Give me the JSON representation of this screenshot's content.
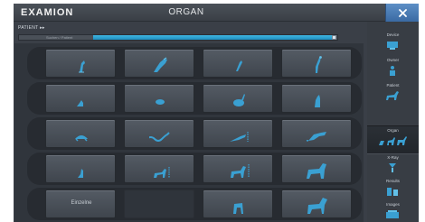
{
  "app": {
    "logo": "EXAMION",
    "title": "ORGAN",
    "close_icon": "close-icon"
  },
  "patient": {
    "label": "PATIENT ▸▸",
    "search_label": "Suchen / Patient",
    "search_value": ""
  },
  "grid": {
    "rows": [
      {
        "tiles": [
          {
            "icon": "rabbit-leg-icon"
          },
          {
            "icon": "small-animal-skull-icon"
          },
          {
            "icon": "small-animal-limb-icon"
          },
          {
            "icon": "bird-icon"
          }
        ]
      },
      {
        "tiles": [
          {
            "icon": "rodent-leg-icon"
          },
          {
            "icon": "fish-body-icon"
          },
          {
            "icon": "rabbit-icon"
          },
          {
            "icon": "bird-upright-icon"
          }
        ]
      },
      {
        "tiles": [
          {
            "icon": "turtle-icon"
          },
          {
            "icon": "snake-icon"
          },
          {
            "icon": "lizard-icon"
          },
          {
            "icon": "large-lizard-icon"
          }
        ]
      },
      {
        "tiles": [
          {
            "icon": "dog-leg-icon"
          },
          {
            "icon": "small-dog-icon"
          },
          {
            "icon": "medium-dog-icon"
          },
          {
            "icon": "large-dog-icon"
          }
        ]
      },
      {
        "tiles": [
          {
            "label": "Einzelne",
            "icon": ""
          },
          {
            "icon": ""
          },
          {
            "icon": "horse-leg-icon"
          },
          {
            "icon": "horse-icon"
          }
        ]
      }
    ]
  },
  "sidebar": {
    "items": [
      {
        "label": "Device",
        "icon": "device-icon"
      },
      {
        "label": "Owner",
        "icon": "owner-icon"
      },
      {
        "label": "Patient",
        "icon": "patient-icon"
      },
      {
        "label": "Organ",
        "icon": "organ-icon"
      },
      {
        "label": "X-Ray",
        "icon": "xray-icon"
      },
      {
        "label": "Results",
        "icon": "results-icon"
      },
      {
        "label": "Images",
        "icon": "images-icon"
      }
    ]
  },
  "colors": {
    "accent": "#2fa6d8",
    "tile": "#4a5058",
    "background": "#3a3f47"
  }
}
